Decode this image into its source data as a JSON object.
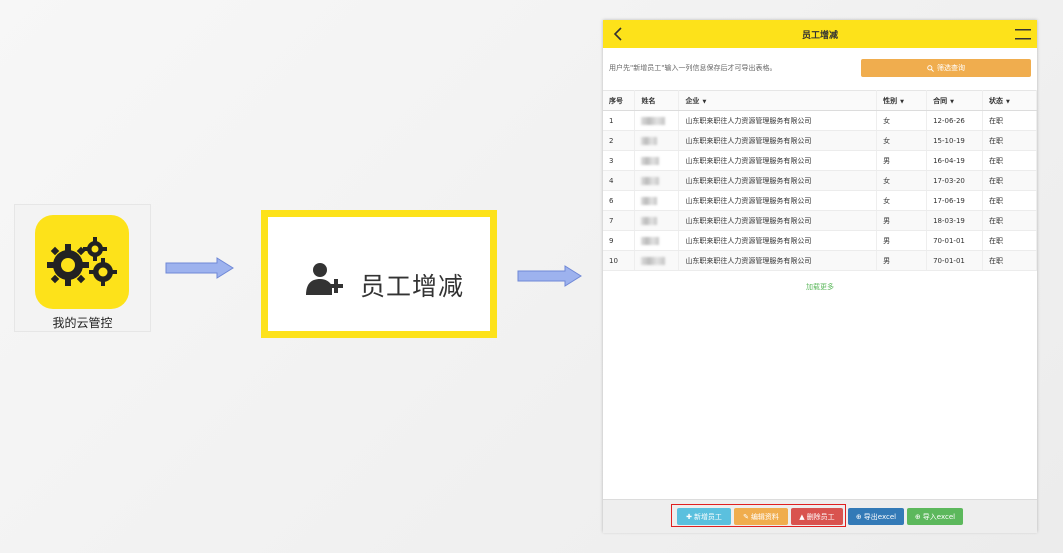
{
  "app_tile": {
    "label": "我的云管控",
    "icon": "gears-icon"
  },
  "menu_tile": {
    "label": "员工增减",
    "icon": "add-user-icon"
  },
  "phone": {
    "title": "员工增减",
    "hint": "用户先\"新增员工\"输入一列信息保存后才可导出表格。",
    "filter_button": "筛选查询",
    "columns": [
      "序号",
      "姓名",
      "企业",
      "性别",
      "合同",
      "状态"
    ],
    "rows": [
      {
        "no": "1",
        "company": "山东职来职往人力资源管理服务有限公司",
        "gender": "女",
        "contract": "12-06-26",
        "status": "在职"
      },
      {
        "no": "2",
        "company": "山东职来职往人力资源管理服务有限公司",
        "gender": "女",
        "contract": "15-10-19",
        "status": "在职"
      },
      {
        "no": "3",
        "company": "山东职来职往人力资源管理服务有限公司",
        "gender": "男",
        "contract": "16-04-19",
        "status": "在职"
      },
      {
        "no": "4",
        "company": "山东职来职往人力资源管理服务有限公司",
        "gender": "女",
        "contract": "17-03-20",
        "status": "在职"
      },
      {
        "no": "6",
        "company": "山东职来职往人力资源管理服务有限公司",
        "gender": "女",
        "contract": "17-06-19",
        "status": "在职"
      },
      {
        "no": "7",
        "company": "山东职来职往人力资源管理服务有限公司",
        "gender": "男",
        "contract": "18-03-19",
        "status": "在职"
      },
      {
        "no": "9",
        "company": "山东职来职往人力资源管理服务有限公司",
        "gender": "男",
        "contract": "70-01-01",
        "status": "在职"
      },
      {
        "no": "10",
        "company": "山东职来职往人力资源管理服务有限公司",
        "gender": "男",
        "contract": "70-01-01",
        "status": "在职"
      }
    ],
    "load_more": "加载更多",
    "buttons": {
      "add": "新增员工",
      "edit": "编辑资料",
      "delete": "删除员工",
      "export": "导出excel",
      "import": "导入excel"
    }
  },
  "colors": {
    "accent": "#fde21a",
    "add": "#5bc0de",
    "edit": "#f0ad4e",
    "delete": "#d9534f",
    "export": "#337ab7",
    "import": "#5cb85c"
  }
}
